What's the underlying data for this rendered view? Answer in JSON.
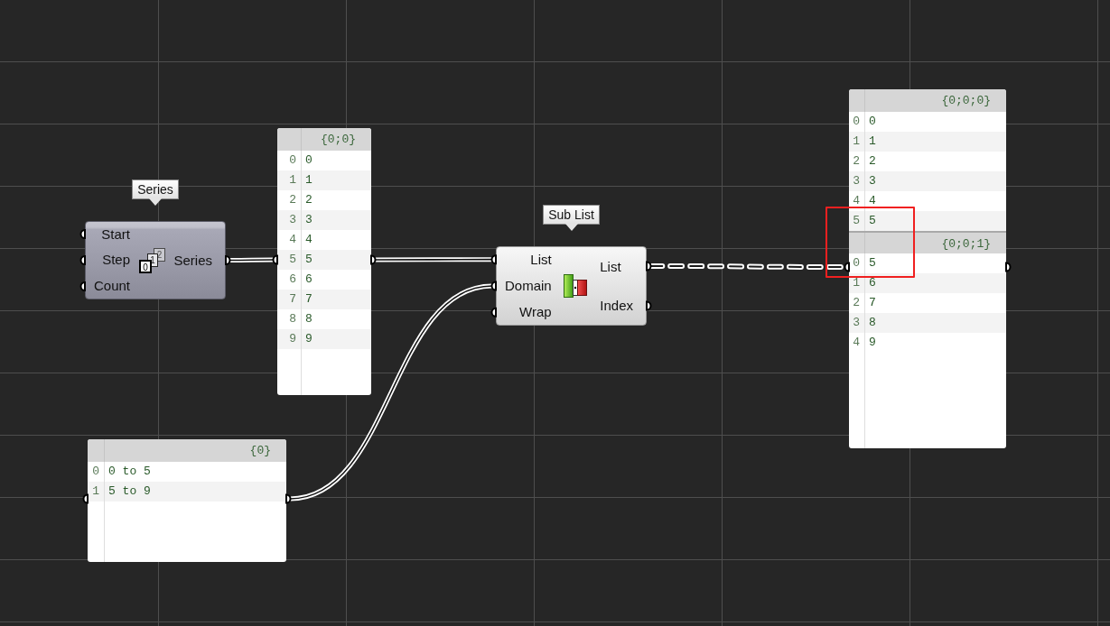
{
  "nodes": [
    {
      "kind": "component",
      "tooltip": "Series",
      "preview": false,
      "icon_labels": [
        "0",
        "1",
        "2"
      ],
      "inputs": [
        "Start",
        "Step",
        "Count"
      ],
      "outputs": [
        "Series"
      ]
    },
    {
      "kind": "panel",
      "branches": [
        {
          "path": "{0;0}",
          "rows": [
            {
              "index": "0",
              "value": "0"
            },
            {
              "index": "1",
              "value": "1"
            },
            {
              "index": "2",
              "value": "2"
            },
            {
              "index": "3",
              "value": "3"
            },
            {
              "index": "4",
              "value": "4"
            },
            {
              "index": "5",
              "value": "5"
            },
            {
              "index": "6",
              "value": "6"
            },
            {
              "index": "7",
              "value": "7"
            },
            {
              "index": "8",
              "value": "8"
            },
            {
              "index": "9",
              "value": "9"
            }
          ]
        }
      ]
    },
    {
      "kind": "panel",
      "branches": [
        {
          "path": "{0}",
          "rows": [
            {
              "index": "0",
              "value": "0 to 5"
            },
            {
              "index": "1",
              "value": "5 to 9"
            }
          ]
        }
      ]
    },
    {
      "kind": "component",
      "tooltip": "Sub List",
      "preview": true,
      "inputs": [
        "List",
        "Domain",
        "Wrap"
      ],
      "outputs": [
        "List",
        "Index"
      ]
    },
    {
      "kind": "panel",
      "branches": [
        {
          "path": "{0;0;0}",
          "rows": [
            {
              "index": "0",
              "value": "0"
            },
            {
              "index": "1",
              "value": "1"
            },
            {
              "index": "2",
              "value": "2"
            },
            {
              "index": "3",
              "value": "3"
            },
            {
              "index": "4",
              "value": "4"
            },
            {
              "index": "5",
              "value": "5"
            }
          ]
        },
        {
          "path": "{0;0;1}",
          "rows": [
            {
              "index": "0",
              "value": "5"
            },
            {
              "index": "1",
              "value": "6"
            },
            {
              "index": "2",
              "value": "7"
            },
            {
              "index": "3",
              "value": "8"
            },
            {
              "index": "4",
              "value": "9"
            }
          ]
        }
      ]
    }
  ],
  "wires": [
    {
      "kind": "item"
    },
    {
      "kind": "item"
    },
    {
      "kind": "item"
    },
    {
      "kind": "tree"
    }
  ]
}
